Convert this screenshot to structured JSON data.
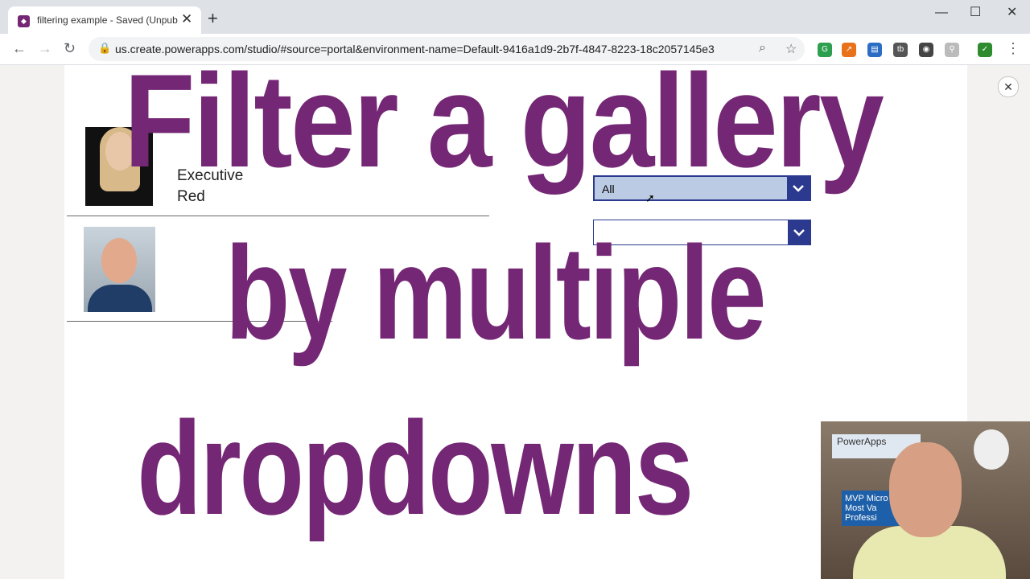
{
  "browser": {
    "tab_title": "filtering example - Saved (Unpublished)",
    "url": "us.create.powerapps.com/studio/#source=portal&environment-name=Default-9416a1d9-2b7f-4847-8223-18c2057145e3"
  },
  "gallery": {
    "record1": {
      "line2": "Executive",
      "line3": "Red"
    }
  },
  "filters": {
    "dropdown1_value": "All",
    "dropdown2_value": ""
  },
  "overlay": {
    "line1": "Filter a gallery",
    "line2": "by multiple",
    "line3": "dropdowns"
  },
  "webcam": {
    "banner_text": "PowerApps",
    "badge_text": "MVP Micro Most Va Professi"
  },
  "colors": {
    "overlay_purple": "#742774",
    "dropdown_accent": "#2b3a8f"
  }
}
